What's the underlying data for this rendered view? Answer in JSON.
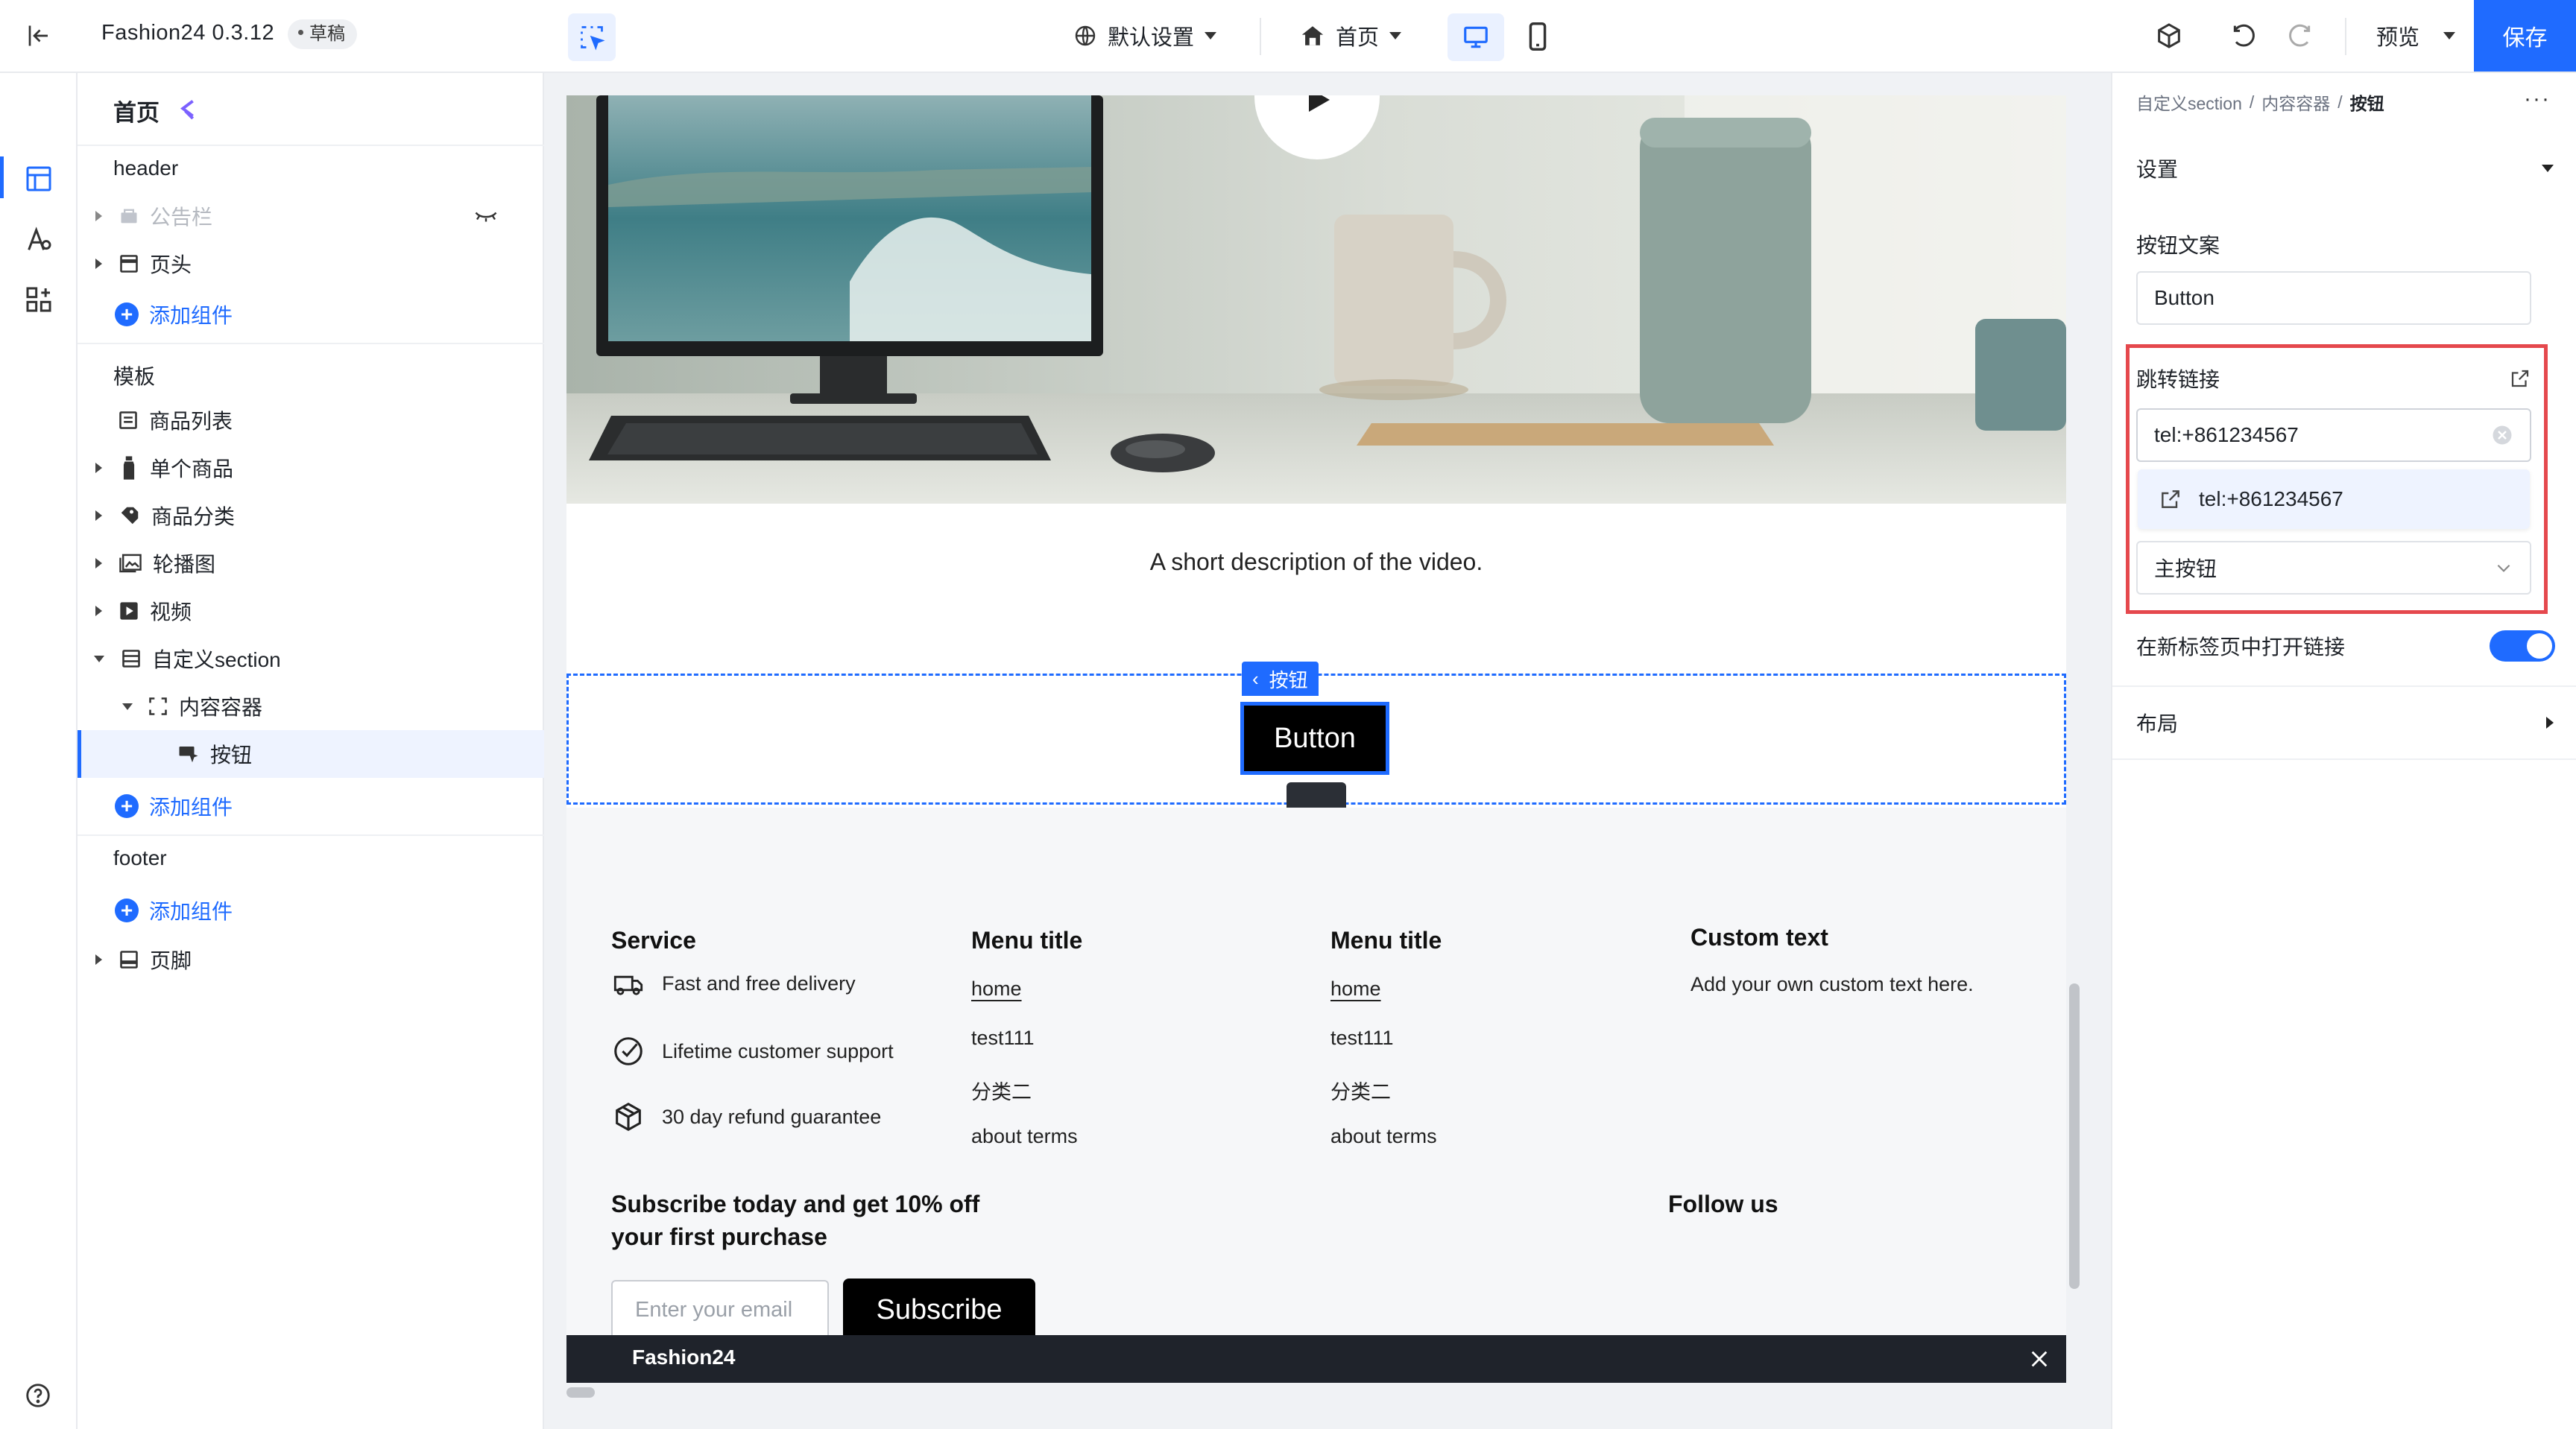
{
  "topbar": {
    "app_title": "Fashion24 0.3.12",
    "status_badge": "草稿",
    "locale_label": "默认设置",
    "page_select": "首页",
    "preview_label": "预览",
    "save_label": "保存"
  },
  "outline": {
    "page_title": "首页",
    "sections": {
      "header": "header",
      "template": "模板",
      "footer": "footer"
    },
    "header_items": [
      "公告栏",
      "页头"
    ],
    "template_items": [
      "商品列表",
      "单个商品",
      "商品分类",
      "轮播图",
      "视频",
      "自定义section"
    ],
    "nested": {
      "container": "内容容器",
      "button": "按钮"
    },
    "footer_items": [
      "页脚"
    ],
    "add_component": "添加组件"
  },
  "canvas": {
    "video_description": "A short description of the video.",
    "selected_tag": "按钮",
    "button_label": "Button",
    "footer": {
      "service_title": "Service",
      "service_items": [
        "Fast and free delivery",
        "Lifetime customer support",
        "30 day refund guarantee"
      ],
      "menu1_title": "Menu title",
      "menu1_items": [
        "home",
        "test111",
        "分类二",
        "about terms"
      ],
      "menu2_title": "Menu title",
      "menu2_items": [
        "home",
        "test111",
        "分类二",
        "about terms"
      ],
      "custom_title": "Custom text",
      "custom_text": "Add your own custom text here.",
      "subscribe_title_line1": "Subscribe today and get 10% off",
      "subscribe_title_line2": "your first purchase",
      "email_placeholder": "Enter your email",
      "subscribe_button": "Subscribe",
      "follow_us": "Follow us"
    },
    "bottom_bar_brand": "Fashion24"
  },
  "props": {
    "breadcrumb": [
      "自定义section",
      "内容容器",
      "按钮"
    ],
    "settings_label": "设置",
    "button_text_label": "按钮文案",
    "button_text_value": "Button",
    "link_label": "跳转链接",
    "link_value": "tel:+861234567",
    "link_suggestion": "tel:+861234567",
    "button_style_value": "主按钮",
    "new_tab_label": "在新标签页中打开链接",
    "new_tab_enabled": true,
    "layout_label": "布局"
  },
  "colors": {
    "accent": "#1f6bff",
    "highlight_box": "#e5484d",
    "dark_button": "#000000"
  }
}
